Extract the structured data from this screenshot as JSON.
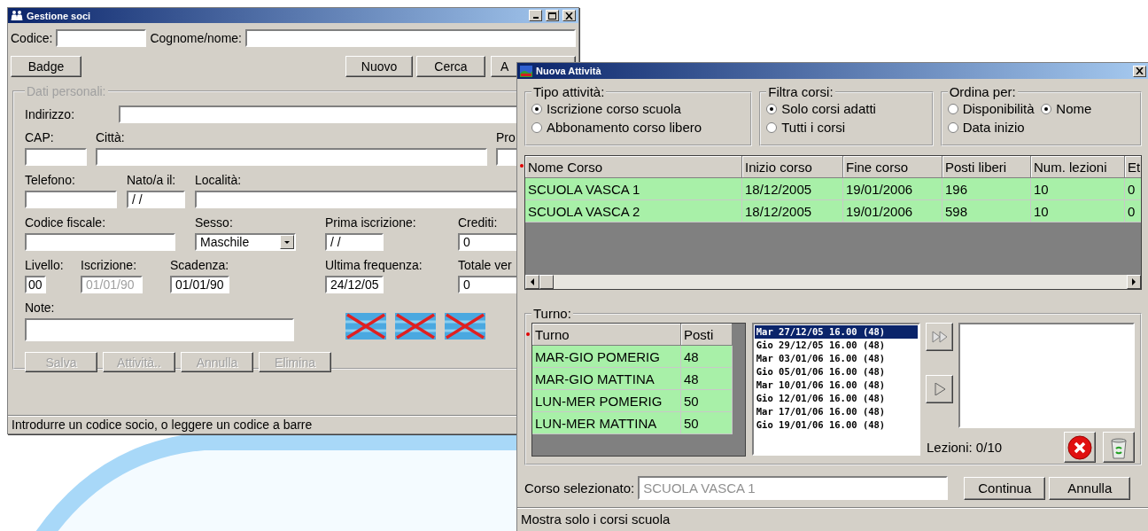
{
  "member_window": {
    "title": "Gestione soci",
    "search": [
      {
        "label": "Codice:"
      },
      {
        "label": "Cognome/nome:"
      }
    ],
    "toolbar_buttons": [
      {
        "label": "Badge"
      },
      {
        "label": "Nuovo"
      },
      {
        "label": "Cerca"
      },
      {
        "label": "A"
      }
    ],
    "personal_data": {
      "legend": "Dati personali:",
      "disabled": true,
      "field_rows": [
        [
          {
            "label": "Indirizzo:"
          }
        ],
        [
          {
            "label": "CAP:"
          },
          {
            "label": "Città:"
          },
          {
            "label": "Pro"
          }
        ],
        [
          {
            "label": "Telefono:"
          },
          {
            "label": "Nato/a il:",
            "value": "/ /"
          },
          {
            "label": "Località:"
          }
        ],
        [
          {
            "label": "Codice fiscale:"
          },
          {
            "label": "Sesso:",
            "value": "Maschile",
            "kind": "combo"
          },
          {
            "label": "Prima iscrizione:",
            "value": "/ /"
          },
          {
            "label": "Crediti:",
            "value": "0"
          }
        ],
        [
          {
            "label": "Livello:",
            "value": "00"
          },
          {
            "label": "Iscrizione:",
            "value": "01/01/90",
            "disabled": true
          },
          {
            "label": "Scadenza:",
            "value": "01/01/90"
          },
          {
            "label": "Ultima frequenza:",
            "value": "24/12/05"
          },
          {
            "label": "Totale ver",
            "value": "0"
          }
        ],
        [
          {
            "label": "Note:"
          }
        ]
      ],
      "buttons": [
        {
          "label": "Salva",
          "disabled": true
        },
        {
          "label": "Attività..",
          "disabled": true
        },
        {
          "label": "Annulla",
          "disabled": true
        },
        {
          "label": "Elimina",
          "disabled": true
        }
      ]
    },
    "status_bar": "Introdurre un codice socio, o leggere un codice a barre"
  },
  "activity_window": {
    "title": "Nuova Attività",
    "activity_type": {
      "legend": "Tipo attività:",
      "options": [
        {
          "label": "Iscrizione corso scuola",
          "selected": true
        },
        {
          "label": "Abbonamento corso libero",
          "selected": false
        }
      ]
    },
    "course_filter": {
      "legend": "Filtra corsi:",
      "options": [
        {
          "label": "Solo corsi adatti",
          "selected": true
        },
        {
          "label": "Tutti i corsi",
          "selected": false
        }
      ]
    },
    "sort_by": {
      "legend": "Ordina per:",
      "options": [
        {
          "label": "Disponibilità",
          "selected": false
        },
        {
          "label": "Nome",
          "selected": true
        },
        {
          "label": "Data inizio",
          "selected": false
        }
      ]
    },
    "courses": {
      "columns": [
        "Nome Corso",
        "Inizio corso",
        "Fine corso",
        "Posti liberi",
        "Num. lezioni",
        "Et"
      ],
      "rows": [
        [
          "SCUOLA VASCA 1",
          "18/12/2005",
          "19/01/2006",
          "196",
          "10",
          "0"
        ],
        [
          "SCUOLA VASCA 2",
          "18/12/2005",
          "19/01/2006",
          "598",
          "10",
          "0"
        ]
      ]
    },
    "shift": {
      "legend": "Turno:",
      "columns": [
        "Turno",
        "Posti"
      ],
      "rows": [
        [
          "MAR-GIO POMERIG",
          "48"
        ],
        [
          "MAR-GIO MATTINA",
          "48"
        ],
        [
          "LUN-MER POMERIG",
          "50"
        ],
        [
          "LUN-MER MATTINA",
          "50"
        ]
      ],
      "dates": [
        {
          "label": "Mar 27/12/05 16.00 (48)",
          "selected": true
        },
        {
          "label": "Gio 29/12/05 16.00 (48)",
          "selected": false
        },
        {
          "label": "Mar 03/01/06 16.00 (48)",
          "selected": false
        },
        {
          "label": "Gio 05/01/06 16.00 (48)",
          "selected": false
        },
        {
          "label": "Mar 10/01/06 16.00 (48)",
          "selected": false
        },
        {
          "label": "Gio 12/01/06 16.00 (48)",
          "selected": false
        },
        {
          "label": "Mar 17/01/06 16.00 (48)",
          "selected": false
        },
        {
          "label": "Gio 19/01/06 16.00 (48)",
          "selected": false
        }
      ],
      "lessons": "Lezioni: 0/10"
    },
    "selected_course": {
      "label": "Corso selezionato:",
      "value": "SCUOLA VASCA 1"
    },
    "buttons": [
      {
        "label": "Continua"
      },
      {
        "label": "Annulla"
      }
    ],
    "status_bar": "Mostra solo i corsi scuola"
  }
}
